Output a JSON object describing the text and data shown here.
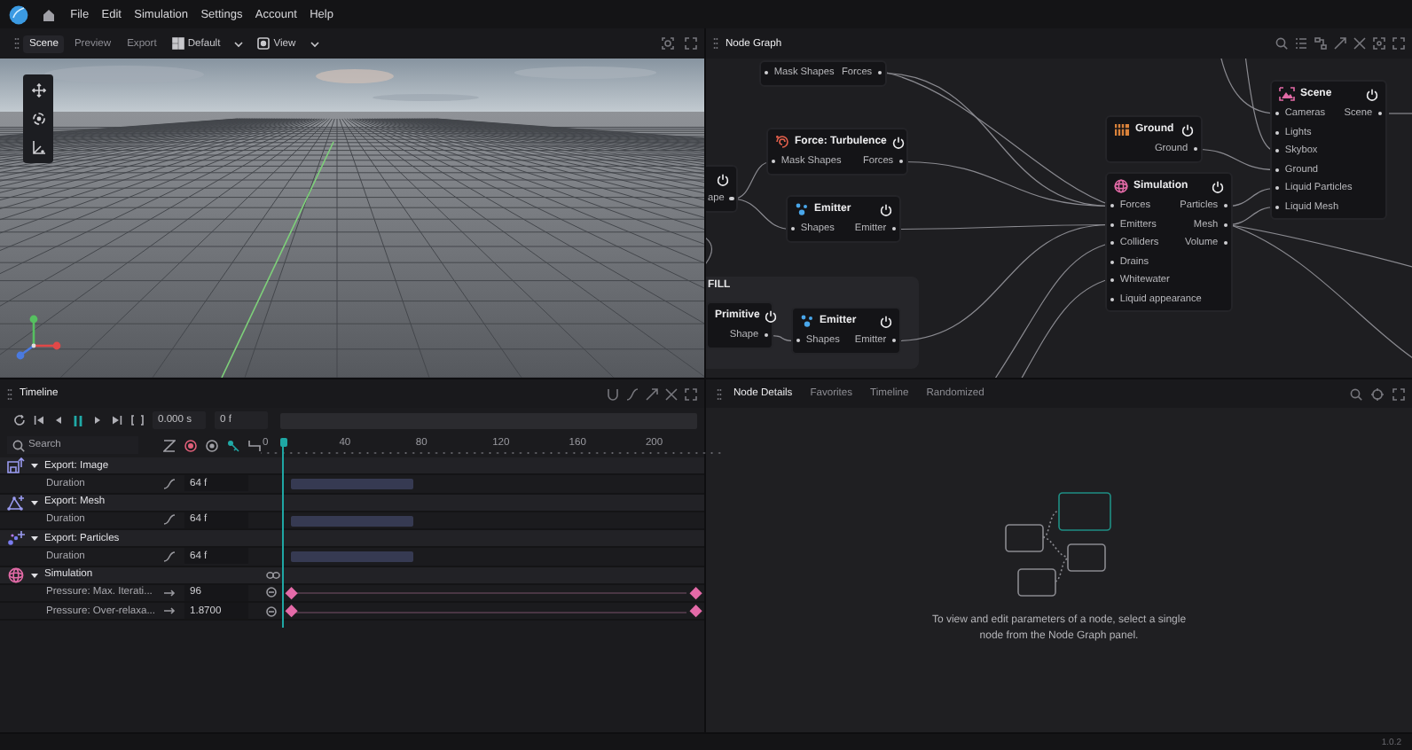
{
  "menu": {
    "items": [
      "File",
      "Edit",
      "Simulation",
      "Settings",
      "Account",
      "Help"
    ]
  },
  "scene_panel": {
    "tabs": [
      {
        "label": "Scene",
        "selected": true
      },
      {
        "label": "Preview",
        "selected": false
      },
      {
        "label": "Export",
        "selected": false
      }
    ],
    "layout": "Default",
    "view": "View"
  },
  "node_graph": {
    "title": "Node Graph",
    "groups": [
      {
        "label": "FILL"
      }
    ],
    "nodes": [
      {
        "kind": "cut-top",
        "inputs": [
          "Mask Shapes"
        ],
        "outputs": [
          "Forces"
        ]
      },
      {
        "kind": "turbulence",
        "title": "Force: Turbulence",
        "inputs": [
          "Mask Shapes"
        ],
        "outputs": [
          "Forces"
        ]
      },
      {
        "kind": "cut-left",
        "outputs": [
          "ape"
        ]
      },
      {
        "kind": "emitter",
        "title": "Emitter",
        "inputs": [
          "Shapes"
        ],
        "outputs": [
          "Emitter"
        ]
      },
      {
        "kind": "ground",
        "title": "Ground",
        "outputs": [
          "Ground"
        ]
      },
      {
        "kind": "simulation",
        "title": "Simulation",
        "inputs": [
          "Forces",
          "Emitters",
          "Colliders",
          "Drains",
          "Whitewater",
          "Liquid appearance"
        ],
        "outputs": [
          "Particles",
          "Mesh",
          "Volume"
        ]
      },
      {
        "kind": "scene",
        "title": "Scene",
        "inputs": [
          "Cameras",
          "Lights",
          "Skybox",
          "Ground",
          "Liquid Particles",
          "Liquid Mesh"
        ],
        "outputs": [
          "Scene"
        ]
      },
      {
        "kind": "cut-left",
        "title": "Primitive",
        "outputs": [
          "Shape"
        ]
      },
      {
        "kind": "emitter",
        "title": "Emitter",
        "inputs": [
          "Shapes"
        ],
        "outputs": [
          "Emitter"
        ]
      }
    ]
  },
  "timeline": {
    "title": "Timeline",
    "time": "0.000 s",
    "frame": "0 f",
    "search": {
      "placeholder": "Search"
    },
    "ruler": [
      "0",
      "40",
      "80",
      "120",
      "160",
      "200"
    ],
    "tracks": [
      {
        "kind": "image",
        "label": "Export: Image",
        "expanded": true,
        "children": [
          {
            "kind": "duration",
            "label": "Duration",
            "value": "64 f"
          }
        ]
      },
      {
        "kind": "mesh",
        "label": "Export: Mesh",
        "expanded": true,
        "children": [
          {
            "kind": "duration",
            "label": "Duration",
            "value": "64 f"
          }
        ]
      },
      {
        "kind": "particles",
        "label": "Export: Particles",
        "expanded": true,
        "children": [
          {
            "kind": "duration",
            "label": "Duration",
            "value": "64 f"
          }
        ]
      },
      {
        "kind": "simulation",
        "label": "Simulation",
        "expanded": true,
        "children": [
          {
            "kind": "keyframed",
            "label": "Pressure: Max. Iterati...",
            "value": "96"
          },
          {
            "kind": "keyframed",
            "label": "Pressure: Over-relaxa...",
            "value": "1.8700"
          }
        ]
      }
    ]
  },
  "node_details": {
    "tabs": [
      {
        "label": "Node Details",
        "selected": true
      },
      {
        "label": "Favorites",
        "selected": false
      },
      {
        "label": "Timeline",
        "selected": false
      },
      {
        "label": "Randomized",
        "selected": false
      }
    ],
    "message": "To view and edit parameters of a node, select a single node from the Node Graph panel."
  },
  "status_bar": {
    "version": "1.0.2"
  }
}
